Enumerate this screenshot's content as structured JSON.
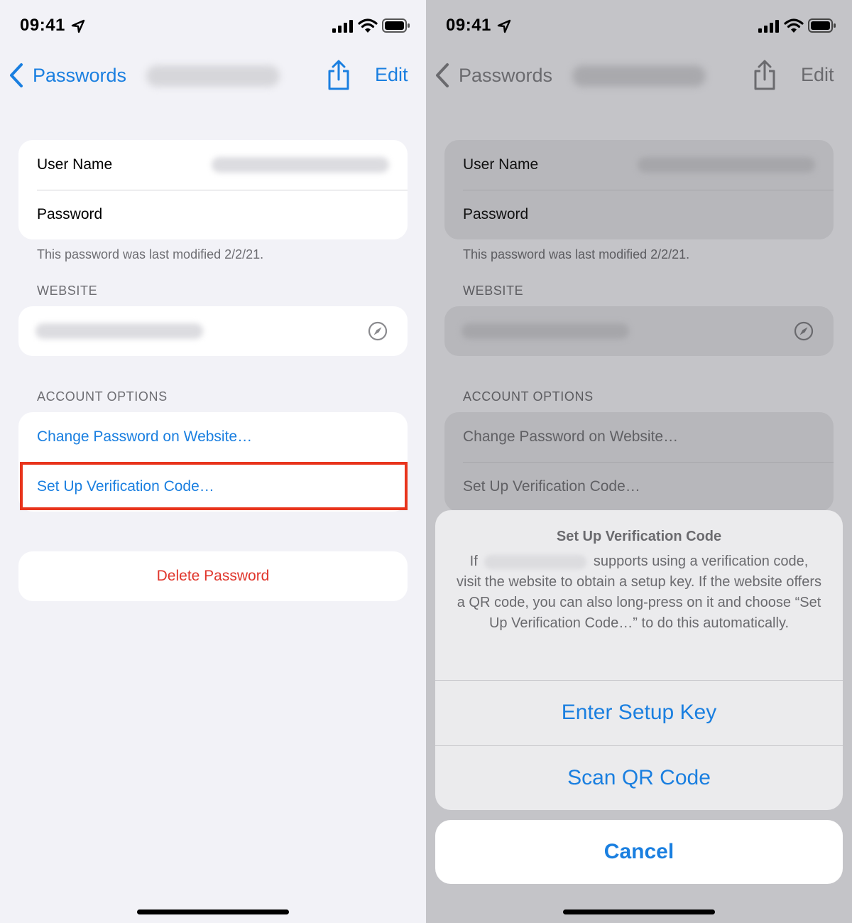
{
  "status_bar": {
    "time": "09:41"
  },
  "nav": {
    "back_label": "Passwords",
    "edit_label": "Edit"
  },
  "credentials": {
    "username_label": "User Name",
    "password_label": "Password"
  },
  "last_modified": "This password was last modified 2/2/21.",
  "website_header": "WEBSITE",
  "account_options": {
    "header": "ACCOUNT OPTIONS",
    "change_password": "Change Password on Website…",
    "setup_verification": "Set Up Verification Code…"
  },
  "delete_label": "Delete Password",
  "sheet": {
    "title": "Set Up Verification Code",
    "message_prefix": "If",
    "message_rest": "supports using a verification code, visit the website to obtain a setup key. If the website offers a QR code, you can also long-press on it and choose “Set Up Verification Code…” to do this automatically.",
    "enter_setup_key": "Enter Setup Key",
    "scan_qr_code": "Scan QR Code",
    "cancel": "Cancel"
  },
  "colors": {
    "accent": "#1a7fe0",
    "destructive": "#e0352b",
    "highlight": "#e8341c"
  },
  "icons": [
    "location-arrow-icon",
    "cellular-signal-icon",
    "wifi-icon",
    "battery-icon",
    "chevron-left-icon",
    "share-icon",
    "compass-icon"
  ]
}
